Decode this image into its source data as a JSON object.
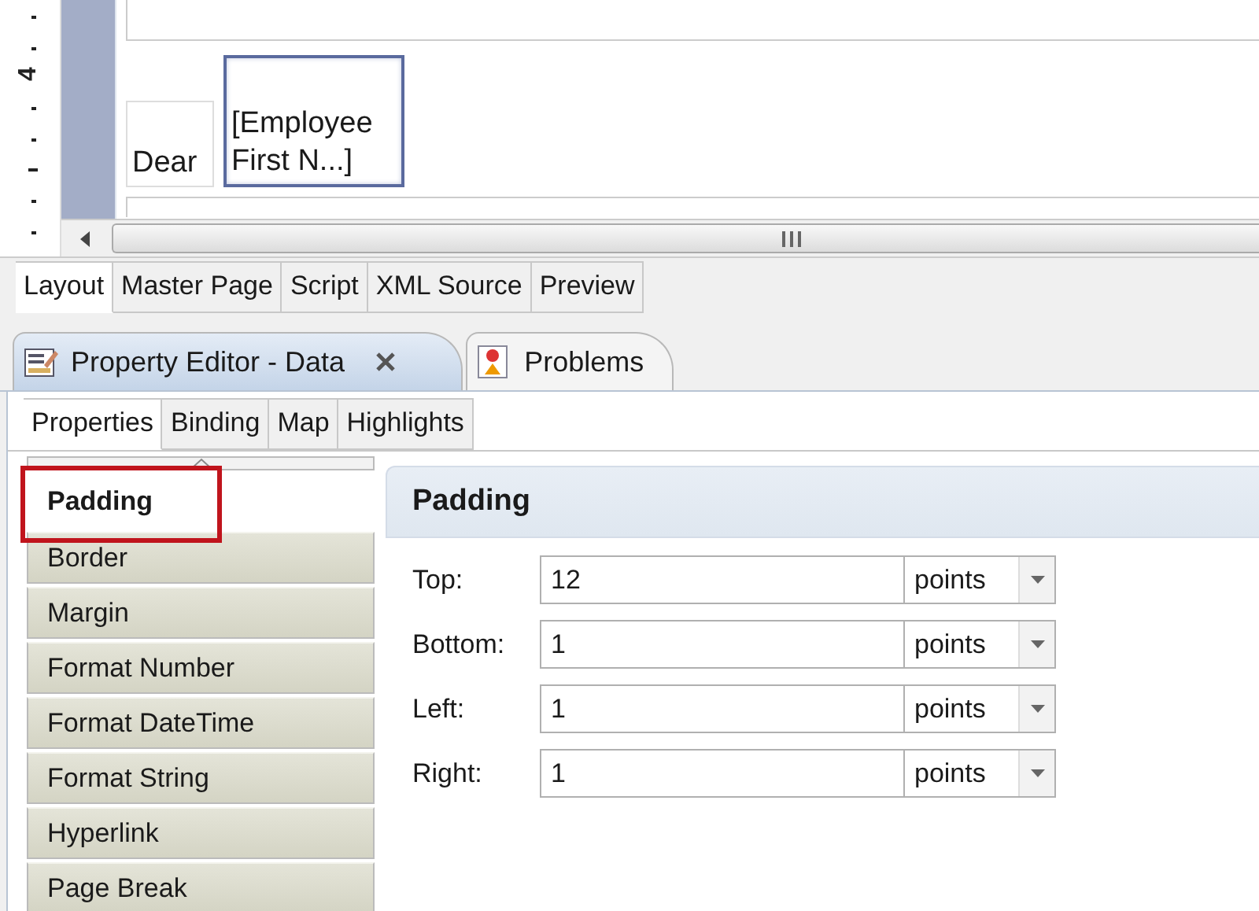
{
  "ruler": {
    "label": "4"
  },
  "canvas": {
    "cells": [
      {
        "text": "Dear",
        "selected": false
      },
      {
        "text": "[Employee First N...]",
        "selected": true
      }
    ]
  },
  "editor_tabs": [
    {
      "label": "Layout",
      "selected": true
    },
    {
      "label": "Master Page",
      "selected": false
    },
    {
      "label": "Script",
      "selected": false
    },
    {
      "label": "XML Source",
      "selected": false
    },
    {
      "label": "Preview",
      "selected": false
    }
  ],
  "views": [
    {
      "label": "Property Editor - Data",
      "selected": true,
      "closable": true,
      "kind": "editor"
    },
    {
      "label": "Problems",
      "selected": false,
      "closable": false,
      "kind": "problems"
    }
  ],
  "property_tabs": [
    {
      "label": "Properties",
      "selected": true
    },
    {
      "label": "Binding",
      "selected": false
    },
    {
      "label": "Map",
      "selected": false
    },
    {
      "label": "Highlights",
      "selected": false
    }
  ],
  "categories": [
    {
      "label": "Padding",
      "selected": true
    },
    {
      "label": "Border",
      "selected": false
    },
    {
      "label": "Margin",
      "selected": false
    },
    {
      "label": "Format Number",
      "selected": false
    },
    {
      "label": "Format DateTime",
      "selected": false
    },
    {
      "label": "Format String",
      "selected": false
    },
    {
      "label": "Hyperlink",
      "selected": false
    },
    {
      "label": "Page Break",
      "selected": false
    }
  ],
  "section": {
    "title": "Padding",
    "fields": [
      {
        "label": "Top:",
        "value": "12",
        "unit": "points"
      },
      {
        "label": "Bottom:",
        "value": "1",
        "unit": "points"
      },
      {
        "label": "Left:",
        "value": "1",
        "unit": "points"
      },
      {
        "label": "Right:",
        "value": "1",
        "unit": "points"
      }
    ]
  }
}
